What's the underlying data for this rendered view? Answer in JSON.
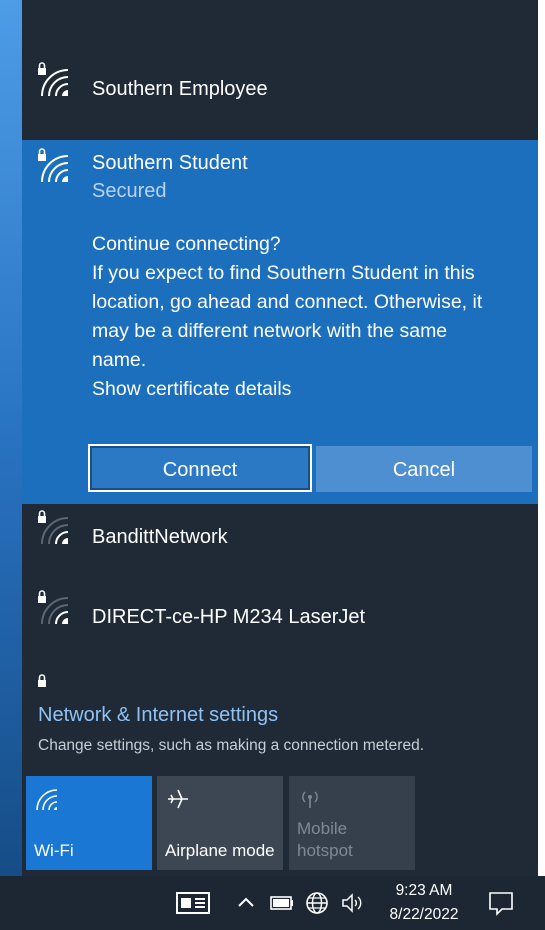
{
  "networks": [
    {
      "name": "Southern Employee"
    },
    {
      "name": "Southern Student",
      "status": "Secured"
    },
    {
      "name": "BandittNetwork"
    },
    {
      "name": "DIRECT-ce-HP M234 LaserJet"
    }
  ],
  "prompt": {
    "question": "Continue connecting?",
    "line1": "If you expect to find Southern Student in this",
    "line2": "location, go ahead and connect. Otherwise, it",
    "line3": "may be a different network with the same",
    "line4": "name.",
    "cert_link": "Show certificate details"
  },
  "buttons": {
    "connect": "Connect",
    "cancel": "Cancel"
  },
  "settings": {
    "link": "Network & Internet settings",
    "description": "Change settings, such as making a connection metered."
  },
  "quick_actions": [
    {
      "label": "Wi-Fi",
      "icon": "wifi-icon",
      "state": "on"
    },
    {
      "label": "Airplane mode",
      "icon": "airplane-icon",
      "state": "off"
    },
    {
      "label_line1": "Mobile",
      "label_line2": "hotspot",
      "icon": "hotspot-icon",
      "state": "disabled"
    }
  ],
  "taskbar": {
    "time": "9:23 AM",
    "date": "8/22/2022"
  },
  "colors": {
    "flyout_bg": "#1f2a36",
    "selected_bg": "#1c6fbd",
    "accent": "#1a78d4",
    "link": "#8ec2f5"
  }
}
